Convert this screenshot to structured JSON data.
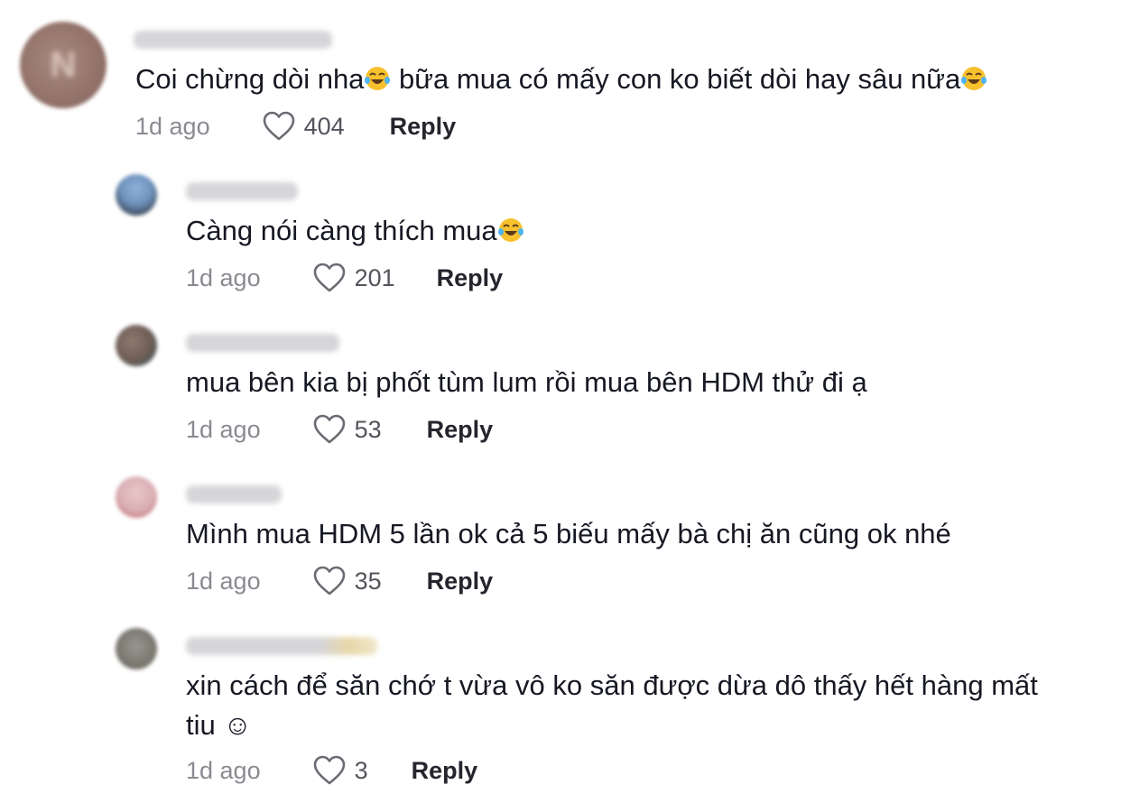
{
  "comments": [
    {
      "avatar_initial": "N",
      "text": "Coi chừng dòi nha",
      "text_after_emoji": " bữa mua có mấy con ko biết dòi hay sâu nữa",
      "time": "1d ago",
      "likes": "404",
      "reply_label": "Reply"
    },
    {
      "text": "Càng nói càng thích mua",
      "time": "1d ago",
      "likes": "201",
      "reply_label": "Reply"
    },
    {
      "text": "mua bên kia bị phốt tùm lum rồi mua bên HDM thử đi ạ",
      "time": "1d ago",
      "likes": "53",
      "reply_label": "Reply"
    },
    {
      "text": "Mình mua HDM 5 lần ok cả 5 biếu mấy bà chị ăn cũng ok nhé",
      "time": "1d ago",
      "likes": "35",
      "reply_label": "Reply"
    },
    {
      "text_line1": "xin cách để săn chớ t vừa vô ko săn được dừa dô thấy hết hàng mất",
      "text_line2": "tiu ☺",
      "time": "1d ago",
      "likes": "3",
      "reply_label": "Reply"
    }
  ],
  "icons": {
    "like": "heart-outline-icon",
    "emoji": "laughing-tears-emoji-icon"
  },
  "colors": {
    "text": "#161823",
    "muted": "#8a8b91",
    "reply": "#24252d"
  }
}
